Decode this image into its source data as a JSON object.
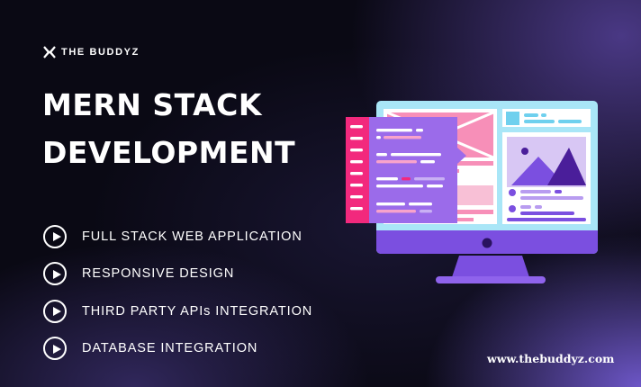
{
  "brand": {
    "name": "THE BUDDYZ",
    "logo_icon": "x-logo-icon"
  },
  "title": {
    "line1": "MERN STACK",
    "line2": "DEVELOPMENT"
  },
  "features": [
    {
      "label": "FULL STACK WEB APPLICATION",
      "icon": "play-circle-icon"
    },
    {
      "label": "RESPONSIVE DESIGN",
      "icon": "play-circle-icon"
    },
    {
      "label": "THIRD PARTY APIs INTEGRATION",
      "icon": "play-circle-icon"
    },
    {
      "label": "DATABASE INTEGRATION",
      "icon": "play-circle-icon"
    }
  ],
  "website": "www.thebuddyz.com",
  "illustration": {
    "name": "monitor-code-illustration",
    "colors": {
      "frame": "#a9e6f7",
      "stand": "#7b4fe0",
      "code_panel": "#9b6bea",
      "accent": "#f2297d",
      "pink": "#f78fb8"
    }
  },
  "colors": {
    "background": "#0a0914",
    "glow": "#7e64e6",
    "text": "#ffffff"
  }
}
